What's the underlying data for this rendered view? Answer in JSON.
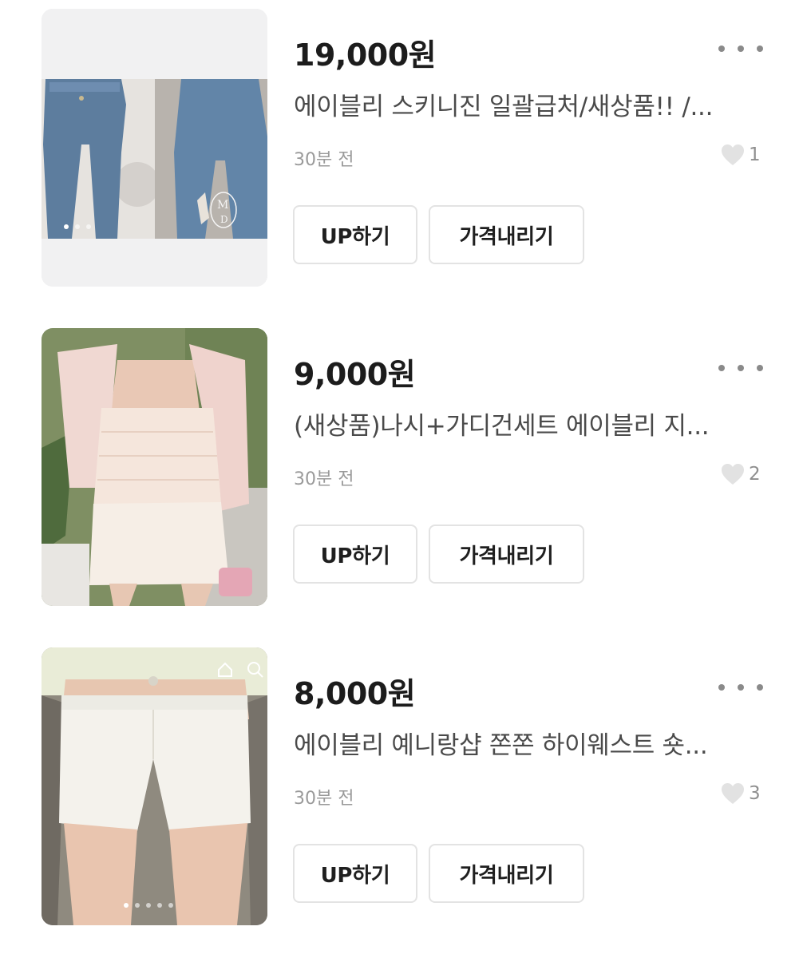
{
  "listings": [
    {
      "price": "19,000원",
      "title": "에이블리 스키니진 일괄급처/새상품!! /...",
      "time": "30분 전",
      "likes": "1",
      "up_label": "UP하기",
      "price_down_label": "가격내리기",
      "image": "jeans-photo"
    },
    {
      "price": "9,000원",
      "title": "(새상품)나시+가디건세트 에이블리 지...",
      "time": "30분 전",
      "likes": "2",
      "up_label": "UP하기",
      "price_down_label": "가격내리기",
      "image": "pink-cardigan-set-photo"
    },
    {
      "price": "8,000원",
      "title": "에이블리 예니랑샵 쫀쫀 하이웨스트 숏...",
      "time": "30분 전",
      "likes": "3",
      "up_label": "UP하기",
      "price_down_label": "가격내리기",
      "image": "white-shorts-photo"
    }
  ],
  "icons": {
    "more": "more-horizontal-icon",
    "like": "heart-icon"
  },
  "colors": {
    "price": "#1c1c1c",
    "title": "#4a4a4a",
    "meta": "#9a9a9a",
    "button_border": "#e3e3e3"
  }
}
